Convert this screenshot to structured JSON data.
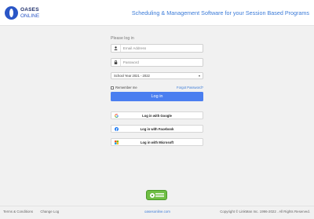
{
  "header": {
    "logo_line1": "OASES",
    "logo_line2": "ONLINE",
    "tagline": "Scheduling & Management Software for your Session Based Programs"
  },
  "login": {
    "prompt": "Please log in",
    "email_placeholder": "Email Address",
    "email_value": "",
    "password_placeholder": "Password",
    "password_value": "",
    "school_year": "School Year 2021 - 2022",
    "remember_label": "Remember me",
    "forgot_label": "Forgot Password?",
    "login_button": "Log in"
  },
  "social": {
    "google": "Log in with Google",
    "facebook": "Log in with Facebook",
    "microsoft": "Log in with Microsoft"
  },
  "footer": {
    "terms": "Terms & Conditions",
    "change_log": "Change Log",
    "site": "oasesonline.com",
    "copyright": "Copyright © LinkMan Inc. 1996-2022 . All Rights Reserved."
  },
  "colors": {
    "accent": "#4a7ef0",
    "link": "#3b7bd8",
    "badge_green": "#6fbe44"
  }
}
